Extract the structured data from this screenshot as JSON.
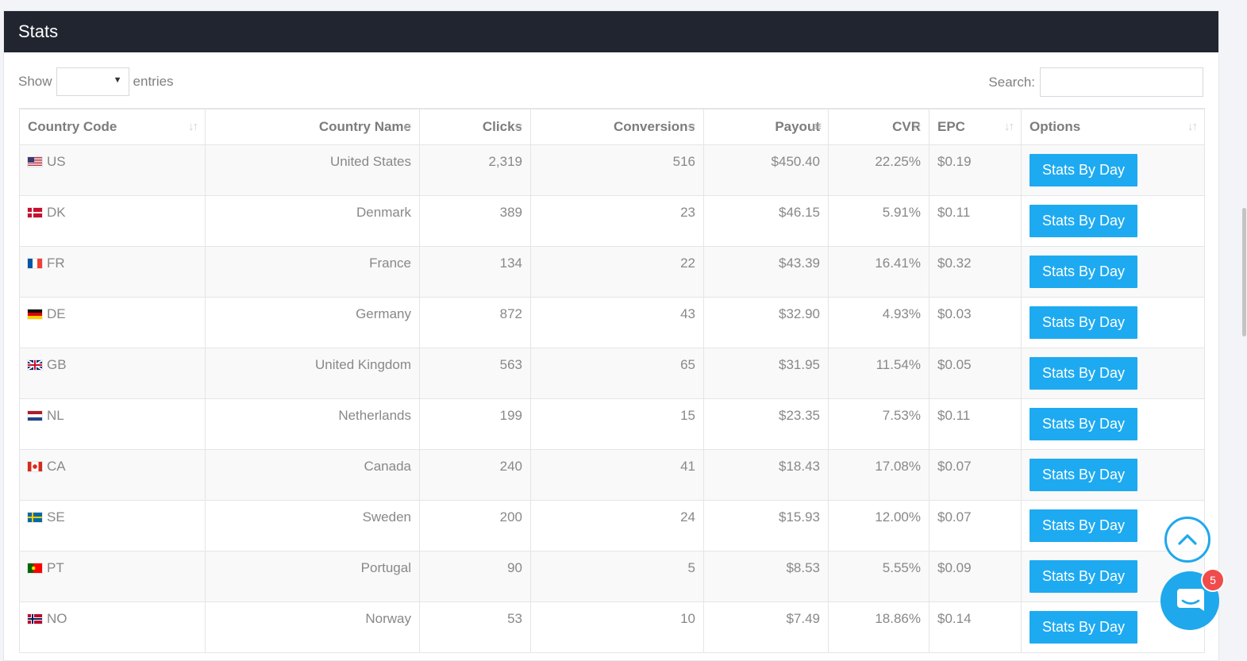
{
  "panel": {
    "title": "Stats"
  },
  "controls": {
    "show_label": "Show",
    "entries_label": "entries",
    "entries_value": "",
    "search_label": "Search:",
    "search_value": ""
  },
  "table": {
    "columns": [
      {
        "label": "Country Code",
        "sorted": false
      },
      {
        "label": "Country Name",
        "sorted": false
      },
      {
        "label": "Clicks",
        "sorted": false
      },
      {
        "label": "Conversions",
        "sorted": false
      },
      {
        "label": "Payout",
        "sorted": true,
        "direction": "desc"
      },
      {
        "label": "CVR",
        "sorted": false
      },
      {
        "label": "EPC",
        "sorted": false
      },
      {
        "label": "Options",
        "sorted": false
      }
    ],
    "rows": [
      {
        "code": "US",
        "flag": "us-flag-icon",
        "name": "United States",
        "clicks": "2,319",
        "conversions": "516",
        "payout": "$450.40",
        "cvr": "22.25%",
        "epc": "$0.19",
        "action": "Stats By Day"
      },
      {
        "code": "DK",
        "flag": "dk-flag-icon",
        "name": "Denmark",
        "clicks": "389",
        "conversions": "23",
        "payout": "$46.15",
        "cvr": "5.91%",
        "epc": "$0.11",
        "action": "Stats By Day"
      },
      {
        "code": "FR",
        "flag": "fr-flag-icon",
        "name": "France",
        "clicks": "134",
        "conversions": "22",
        "payout": "$43.39",
        "cvr": "16.41%",
        "epc": "$0.32",
        "action": "Stats By Day"
      },
      {
        "code": "DE",
        "flag": "de-flag-icon",
        "name": "Germany",
        "clicks": "872",
        "conversions": "43",
        "payout": "$32.90",
        "cvr": "4.93%",
        "epc": "$0.03",
        "action": "Stats By Day"
      },
      {
        "code": "GB",
        "flag": "gb-flag-icon",
        "name": "United Kingdom",
        "clicks": "563",
        "conversions": "65",
        "payout": "$31.95",
        "cvr": "11.54%",
        "epc": "$0.05",
        "action": "Stats By Day"
      },
      {
        "code": "NL",
        "flag": "nl-flag-icon",
        "name": "Netherlands",
        "clicks": "199",
        "conversions": "15",
        "payout": "$23.35",
        "cvr": "7.53%",
        "epc": "$0.11",
        "action": "Stats By Day"
      },
      {
        "code": "CA",
        "flag": "ca-flag-icon",
        "name": "Canada",
        "clicks": "240",
        "conversions": "41",
        "payout": "$18.43",
        "cvr": "17.08%",
        "epc": "$0.07",
        "action": "Stats By Day"
      },
      {
        "code": "SE",
        "flag": "se-flag-icon",
        "name": "Sweden",
        "clicks": "200",
        "conversions": "24",
        "payout": "$15.93",
        "cvr": "12.00%",
        "epc": "$0.07",
        "action": "Stats By Day"
      },
      {
        "code": "PT",
        "flag": "pt-flag-icon",
        "name": "Portugal",
        "clicks": "90",
        "conversions": "5",
        "payout": "$8.53",
        "cvr": "5.55%",
        "epc": "$0.09",
        "action": "Stats By Day"
      },
      {
        "code": "NO",
        "flag": "no-flag-icon",
        "name": "Norway",
        "clicks": "53",
        "conversions": "10",
        "payout": "$7.49",
        "cvr": "18.86%",
        "epc": "$0.14",
        "action": "Stats By Day"
      }
    ]
  },
  "widgets": {
    "scroll_top_icon": "chevron-up-icon",
    "chat_icon": "chat-bubble-icon",
    "chat_badge": "5"
  },
  "colors": {
    "header_bg": "#20252f",
    "accent": "#1eaaf1",
    "badge": "#f04c4c"
  }
}
